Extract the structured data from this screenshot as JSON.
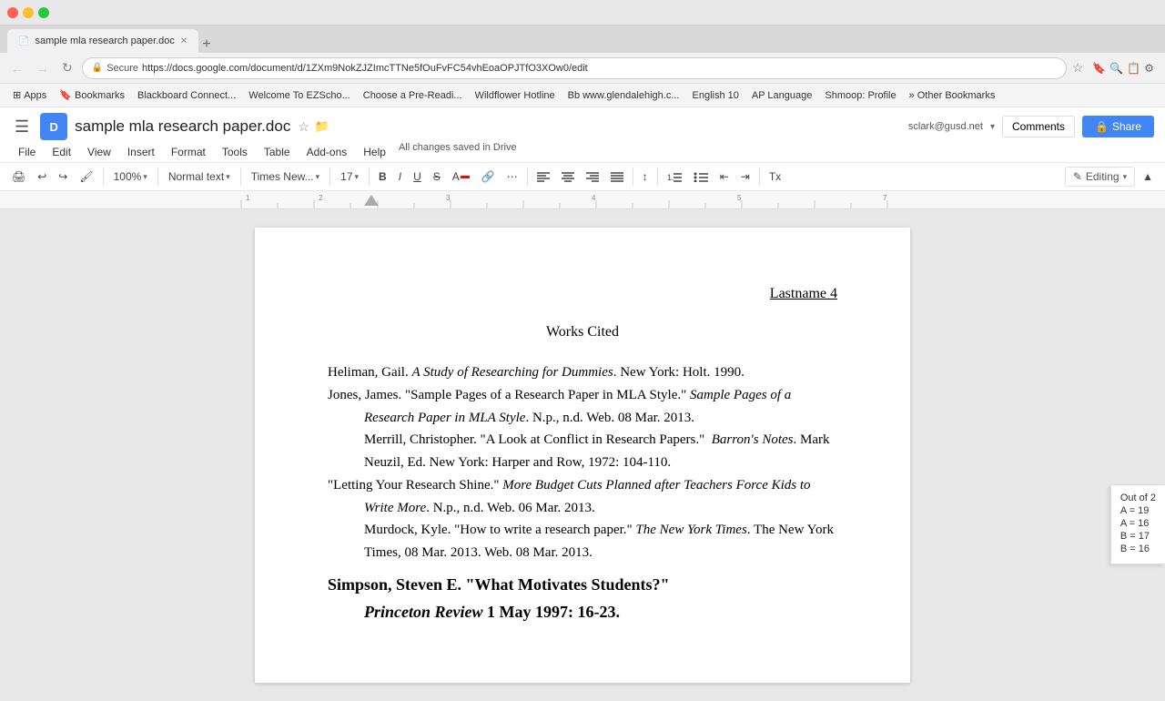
{
  "browser": {
    "tab_title": "sample mla research paper.doc",
    "url": "https://docs.google.com/document/d/1ZXm9NokZJZImcTTNe5fOuFvFC54vhEoaOPJTfO3XOw0/edit",
    "secure_label": "Secure",
    "new_tab_btn": "+",
    "nav_back": "←",
    "nav_forward": "→",
    "nav_refresh": "↻",
    "close_label": "✕"
  },
  "bookmarks": [
    {
      "label": "Apps"
    },
    {
      "label": "Bookmarks"
    },
    {
      "label": "Blackboard Connect..."
    },
    {
      "label": "Welcome To EZScho..."
    },
    {
      "label": "Choose a Pre-Readi..."
    },
    {
      "label": "Wildflower Hotline"
    },
    {
      "label": "www.glendalehigh.c..."
    },
    {
      "label": "English 10"
    },
    {
      "label": "AP Language"
    },
    {
      "label": "Shmoop: Profile"
    },
    {
      "label": "Other Bookmarks"
    }
  ],
  "gdocs": {
    "title": "sample mla research paper.doc",
    "star_icon": "☆",
    "folder_icon": "📁",
    "email": "sclark@gusd.net",
    "comments_label": "Comments",
    "share_label": "Share",
    "share_icon": "🔒",
    "menu_items": [
      "File",
      "Edit",
      "View",
      "Insert",
      "Format",
      "Tools",
      "Table",
      "Add-ons",
      "Help"
    ],
    "autosave": "All changes saved in Drive",
    "editing_label": "Editing"
  },
  "toolbar": {
    "print_icon": "🖨",
    "undo_icon": "↩",
    "redo_icon": "↪",
    "paintformat_icon": "🖌",
    "zoom_label": "100%",
    "style_label": "Normal text",
    "font_label": "Times New...",
    "size_label": "17",
    "bold_label": "B",
    "italic_label": "I",
    "underline_label": "U",
    "strikethrough_label": "S̶",
    "textcolor_label": "A",
    "link_icon": "🔗",
    "more_icon": "⋯",
    "align_left": "≡",
    "align_center": "≡",
    "align_right": "≡",
    "align_justify": "≡",
    "line_spacing": "↕",
    "numbered_list": "1.",
    "bullet_list": "•",
    "decrease_indent": "⇤",
    "increase_indent": "⇥",
    "clear_format": "Tx",
    "chevron": "▾"
  },
  "document": {
    "page_header": "Lastname 4",
    "works_cited_title": "Works Cited",
    "citations": [
      {
        "id": "heliman",
        "text_parts": [
          {
            "text": "Heliman, Gail. ",
            "italic": false
          },
          {
            "text": "A Study of Researching for Dummies",
            "italic": true
          },
          {
            "text": ". New York: Holt. 1990.",
            "italic": false
          }
        ],
        "indent": false
      },
      {
        "id": "jones",
        "text_parts": [
          {
            "text": "Jones, James. \"Sample Pages of a Research Paper in MLA Style.\" ",
            "italic": false
          },
          {
            "text": "Sample Pages of a Research Paper in MLA Style",
            "italic": true
          },
          {
            "text": ". N.p., n.d. Web. 08 Mar. 2013.",
            "italic": false
          }
        ],
        "indent": false
      },
      {
        "id": "merrill",
        "text_parts": [
          {
            "text": "Merrill, Christopher. “A Look at Conflict in Research Papers.”  ",
            "italic": false
          },
          {
            "text": "Barron’s Notes",
            "italic": true
          },
          {
            "text": ". Mark Neuzil, Ed. New York: Harper and Row, 1972: 104-110.",
            "italic": false
          }
        ],
        "indent": true
      },
      {
        "id": "letting",
        "text_parts": [
          {
            "text": "“Letting Your Research Shine.” ",
            "italic": false
          },
          {
            "text": "More Budget Cuts Planned after Teachers Force Kids to Write More",
            "italic": true
          },
          {
            "text": ". N.p., n.d. Web. 06 Mar. 2013.",
            "italic": false
          }
        ],
        "indent": false
      },
      {
        "id": "murdock",
        "text_parts": [
          {
            "text": "Murdock, Kyle. “How to write a research paper.” ",
            "italic": false
          },
          {
            "text": "The New York Times",
            "italic": true
          },
          {
            "text": ". The New York Times, 08 Mar. 2013. Web. 08 Mar. 2013.",
            "italic": false
          }
        ],
        "indent": true
      },
      {
        "id": "simpson",
        "text_parts": [
          {
            "text": "Simpson, Steven E. “What Motivates Students?”",
            "italic": false
          }
        ],
        "indent": false,
        "bold_block": true
      },
      {
        "id": "princeton",
        "text_parts": [
          {
            "text": "Princeton Review",
            "italic": true
          },
          {
            "text": " 1 May 1997: 16-23.",
            "italic": false
          }
        ],
        "indent": true,
        "bold_block": true
      }
    ]
  },
  "score_panel": {
    "title": "Out of 2",
    "a_19": "A = 19",
    "a_16": "A = 16",
    "b_17": "B = 17",
    "b_16": "B = 16"
  }
}
